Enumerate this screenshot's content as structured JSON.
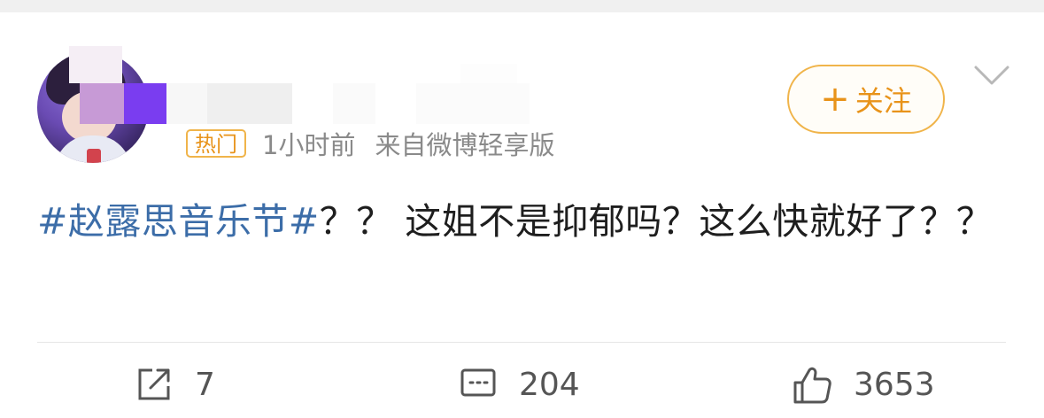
{
  "user": {
    "avatar_icon": "anime-girl-avatar",
    "name_obscured": true
  },
  "meta": {
    "badge": "热门",
    "time": "1小时前",
    "source": "来自微博轻享版"
  },
  "follow_button": {
    "plus": "+",
    "label": "关注"
  },
  "menu_icon": "chevron-down-icon",
  "post": {
    "topic": "#赵露思音乐节#",
    "text": "？？ 这姐不是抑郁吗？这么快就好了？？"
  },
  "actions": {
    "repost_count": "7",
    "comment_count": "204",
    "like_count": "3653"
  },
  "colors": {
    "accent_orange": "#e8931a",
    "topic_blue": "#3c6da8",
    "meta_gray": "#8a8a8a"
  }
}
